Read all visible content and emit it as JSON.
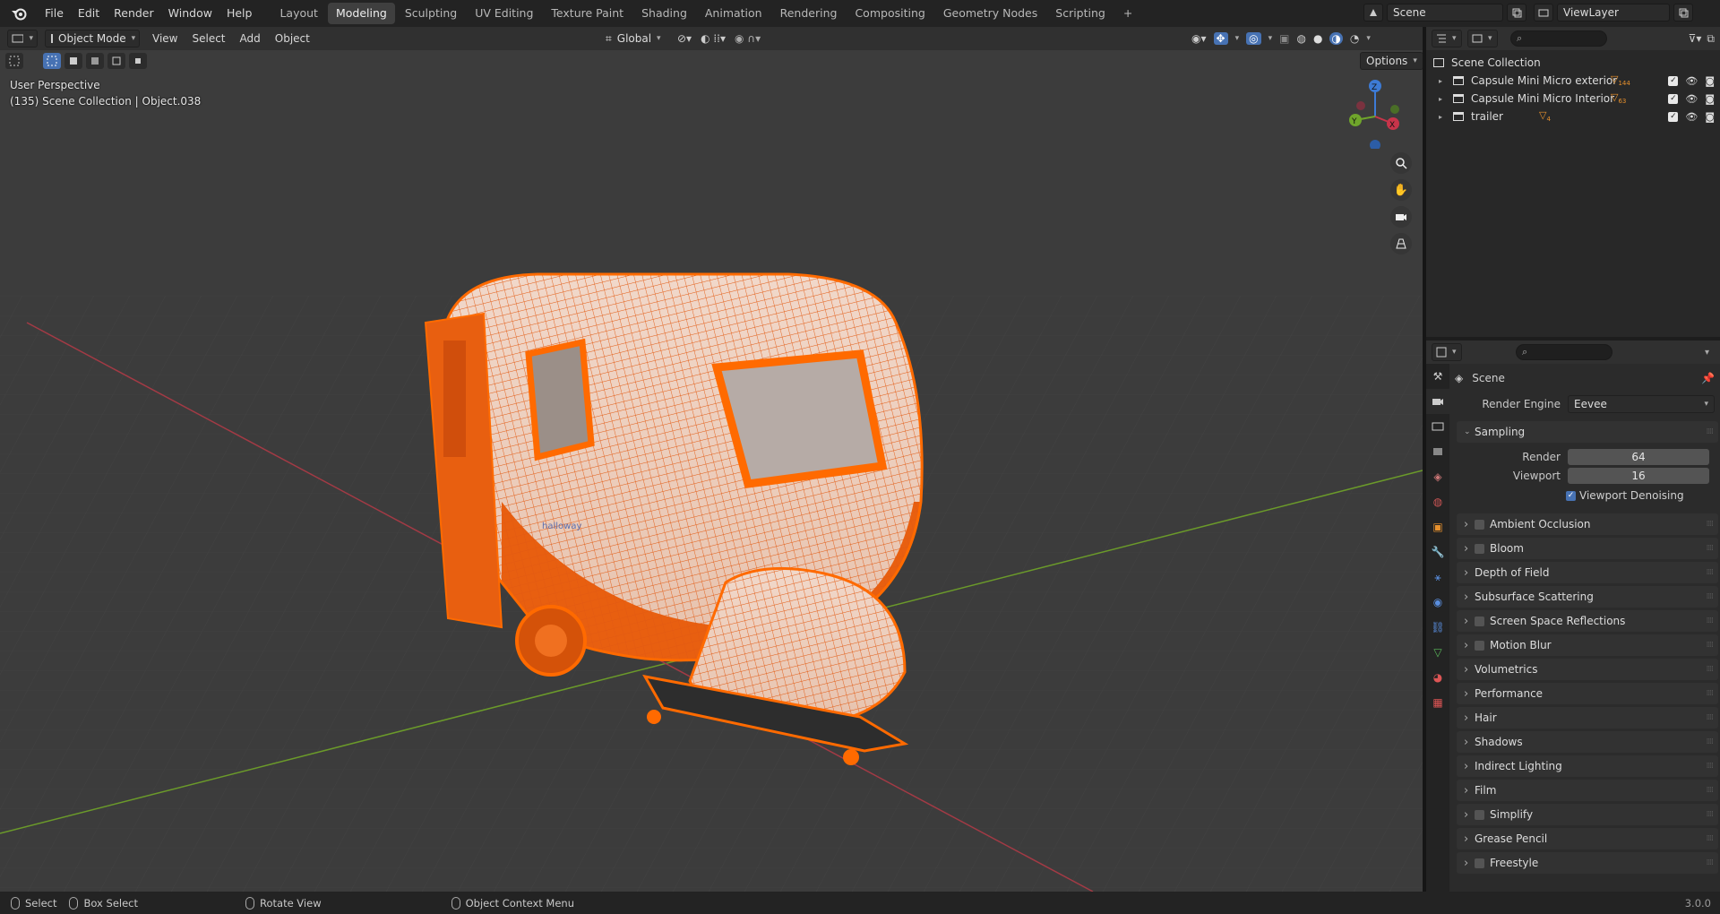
{
  "topbar": {
    "menus": [
      "File",
      "Edit",
      "Render",
      "Window",
      "Help"
    ],
    "workspaces": [
      "Layout",
      "Modeling",
      "Sculpting",
      "UV Editing",
      "Texture Paint",
      "Shading",
      "Animation",
      "Rendering",
      "Compositing",
      "Geometry Nodes",
      "Scripting"
    ],
    "active_workspace": "Modeling",
    "add_tab": "+",
    "scene_name": "Scene",
    "view_layer": "ViewLayer"
  },
  "viewport_header": {
    "mode": "Object Mode",
    "menus": [
      "View",
      "Select",
      "Add",
      "Object"
    ],
    "orientation": "Global",
    "options": "Options"
  },
  "viewport": {
    "view_name": "User Perspective",
    "collection_info": "(135) Scene Collection | Object.038",
    "gizmo_labels": {
      "z": "Z",
      "y": "Y",
      "x": "X"
    },
    "model_label": "halloway"
  },
  "outliner": {
    "root": "Scene Collection",
    "items": [
      {
        "name": "Capsule Mini Micro  exterior",
        "count": "144"
      },
      {
        "name": "Capsule Mini Micro  Interior",
        "count": "63"
      },
      {
        "name": "trailer",
        "count": "4"
      }
    ]
  },
  "properties": {
    "context": "Scene",
    "render_engine_label": "Render Engine",
    "render_engine": "Eevee",
    "sampling": {
      "title": "Sampling",
      "render_label": "Render",
      "render": "64",
      "viewport_label": "Viewport",
      "viewport": "16",
      "denoise_label": "Viewport Denoising"
    },
    "panels": [
      {
        "label": "Ambient Occlusion",
        "checkbox": true
      },
      {
        "label": "Bloom",
        "checkbox": true
      },
      {
        "label": "Depth of Field",
        "checkbox": false
      },
      {
        "label": "Subsurface Scattering",
        "checkbox": false
      },
      {
        "label": "Screen Space Reflections",
        "checkbox": true
      },
      {
        "label": "Motion Blur",
        "checkbox": true
      },
      {
        "label": "Volumetrics",
        "checkbox": false
      },
      {
        "label": "Performance",
        "checkbox": false
      },
      {
        "label": "Hair",
        "checkbox": false
      },
      {
        "label": "Shadows",
        "checkbox": false
      },
      {
        "label": "Indirect Lighting",
        "checkbox": false
      },
      {
        "label": "Film",
        "checkbox": false
      },
      {
        "label": "Simplify",
        "checkbox": true
      },
      {
        "label": "Grease Pencil",
        "checkbox": false
      },
      {
        "label": "Freestyle",
        "checkbox": true
      }
    ]
  },
  "statusbar": {
    "select": "Select",
    "box_select": "Box Select",
    "rotate": "Rotate View",
    "context_menu": "Object Context Menu",
    "version": "3.0.0"
  },
  "colors": {
    "accent": "#4772b3",
    "selection": "#ff6a00",
    "x_axis": "#a33a45",
    "y_axis": "#6b9a2a"
  }
}
